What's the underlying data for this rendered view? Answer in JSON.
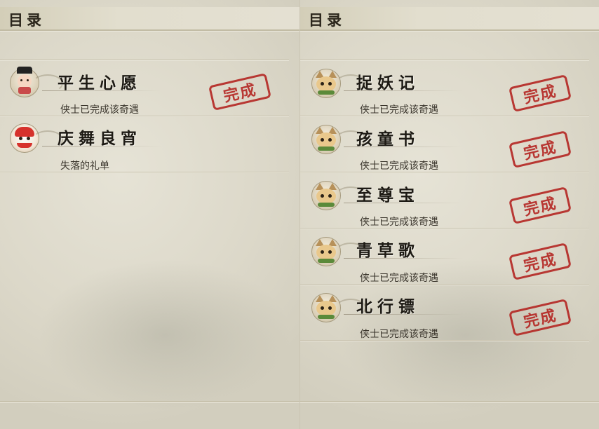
{
  "left_panel": {
    "header": "目录",
    "entries": [
      {
        "title": "平生心愿",
        "subtitle": "侠士已完成该奇遇",
        "icon": "official-figure-icon",
        "stamp_text": "完成"
      },
      {
        "title": "庆舞良宵",
        "subtitle": "失落的礼单",
        "icon": "lion-dance-icon"
      }
    ]
  },
  "right_panel": {
    "header": "目录",
    "entries": [
      {
        "title": "捉妖记",
        "subtitle": "侠士已完成该奇遇",
        "icon": "cat-pet-icon",
        "stamp_text": "完成"
      },
      {
        "title": "孩童书",
        "subtitle": "侠士已完成该奇遇",
        "icon": "cat-pet-icon",
        "stamp_text": "完成"
      },
      {
        "title": "至尊宝",
        "subtitle": "侠士已完成该奇遇",
        "icon": "cat-pet-icon",
        "stamp_text": "完成"
      },
      {
        "title": "青草歌",
        "subtitle": "侠士已完成该奇遇",
        "icon": "cat-pet-icon",
        "stamp_text": "完成"
      },
      {
        "title": "北行镖",
        "subtitle": "侠士已完成该奇遇",
        "icon": "cat-pet-icon",
        "stamp_text": "完成"
      }
    ]
  },
  "colors": {
    "stamp_red": "#b52a26",
    "parchment": "#dcd8c9",
    "title_text": "#1d1a14"
  }
}
